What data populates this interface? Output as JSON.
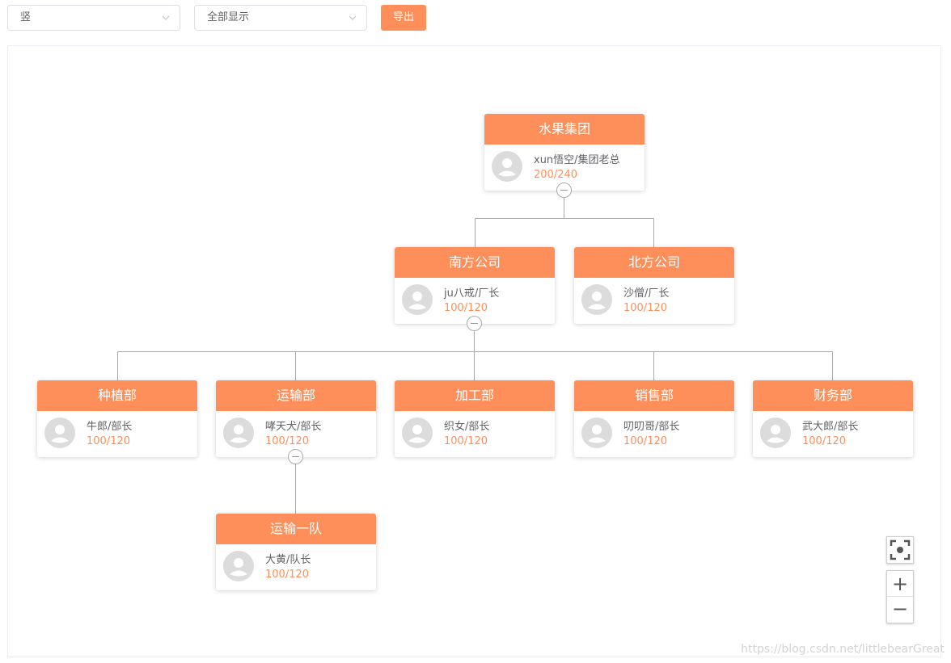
{
  "toolbar": {
    "direction_select": "竖",
    "display_select": "全部显示",
    "export_label": "导出"
  },
  "nodes": {
    "root": {
      "title": "水果集团",
      "person": "xun悟空/集团老总",
      "ratio": "200/240"
    },
    "south": {
      "title": "南方公司",
      "person": "ju八戒/厂长",
      "ratio": "100/120"
    },
    "north": {
      "title": "北方公司",
      "person": "沙僧/厂长",
      "ratio": "100/120"
    },
    "plant": {
      "title": "种植部",
      "person": "牛郎/部长",
      "ratio": "100/120"
    },
    "transport": {
      "title": "运输部",
      "person": "哮天犬/部长",
      "ratio": "100/120"
    },
    "process": {
      "title": "加工部",
      "person": "织女/部长",
      "ratio": "100/120"
    },
    "sales": {
      "title": "销售部",
      "person": "叨叨哥/部长",
      "ratio": "100/120"
    },
    "finance": {
      "title": "财务部",
      "person": "武大郎/部长",
      "ratio": "100/120"
    },
    "team1": {
      "title": "运输一队",
      "person": "大黄/队长",
      "ratio": "100/120"
    }
  },
  "zoom": {
    "fit_icon": "fit-screen-icon",
    "in_label": "+",
    "out_label": "−"
  },
  "watermark": "https://blog.csdn.net/littlebearGreat",
  "colors": {
    "accent": "#ff8f5a",
    "line": "#aaaaaa",
    "avatar": "#dcdcdc"
  }
}
